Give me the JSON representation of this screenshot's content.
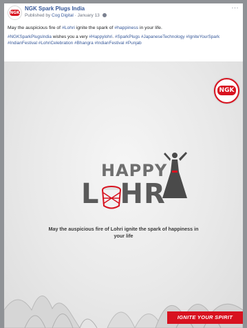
{
  "post": {
    "page_name": "NGK Spark Plugs India",
    "published_prefix": "Published by",
    "publisher": "Cog Digital",
    "date": "January 13",
    "more_label": "···",
    "caption": {
      "t1": "May the auspicious fire of ",
      "h1": "#Lohri",
      "t2": " ignite the spark of ",
      "h2": "#happiness",
      "t3": " in your life."
    },
    "tags": {
      "h1": "#NGKSparkPlugsIndia",
      "t1": " wishes you a very ",
      "h2": "#Happylohri",
      "t2": ". ",
      "h3": "#SparkPlugs",
      "h4": "#JapaneseTechnology",
      "h5": "#IgniteYourSpark",
      "h6": "#IndianFestival",
      "h7": "#LohriCelebration",
      "h8": "#Bhangra",
      "h9": "#IndianFestival",
      "h10": "#Punjab"
    }
  },
  "poster": {
    "brand_badge": "NGK",
    "avatar_logo": "NGK",
    "happy": "HAPPY",
    "lohri_left": "L",
    "lohri_right": "HR",
    "tagline": "May the auspicious fire of Lohri ignite the spark of happiness in your life",
    "cta": "IGNITE YOUR SPIRIT"
  },
  "colors": {
    "brand_red": "#d8121f",
    "link_blue": "#365899",
    "text_dark": "#1c1e21"
  },
  "icons": [
    "globe-icon",
    "more-icon",
    "drum-icon",
    "dancer-icon"
  ]
}
